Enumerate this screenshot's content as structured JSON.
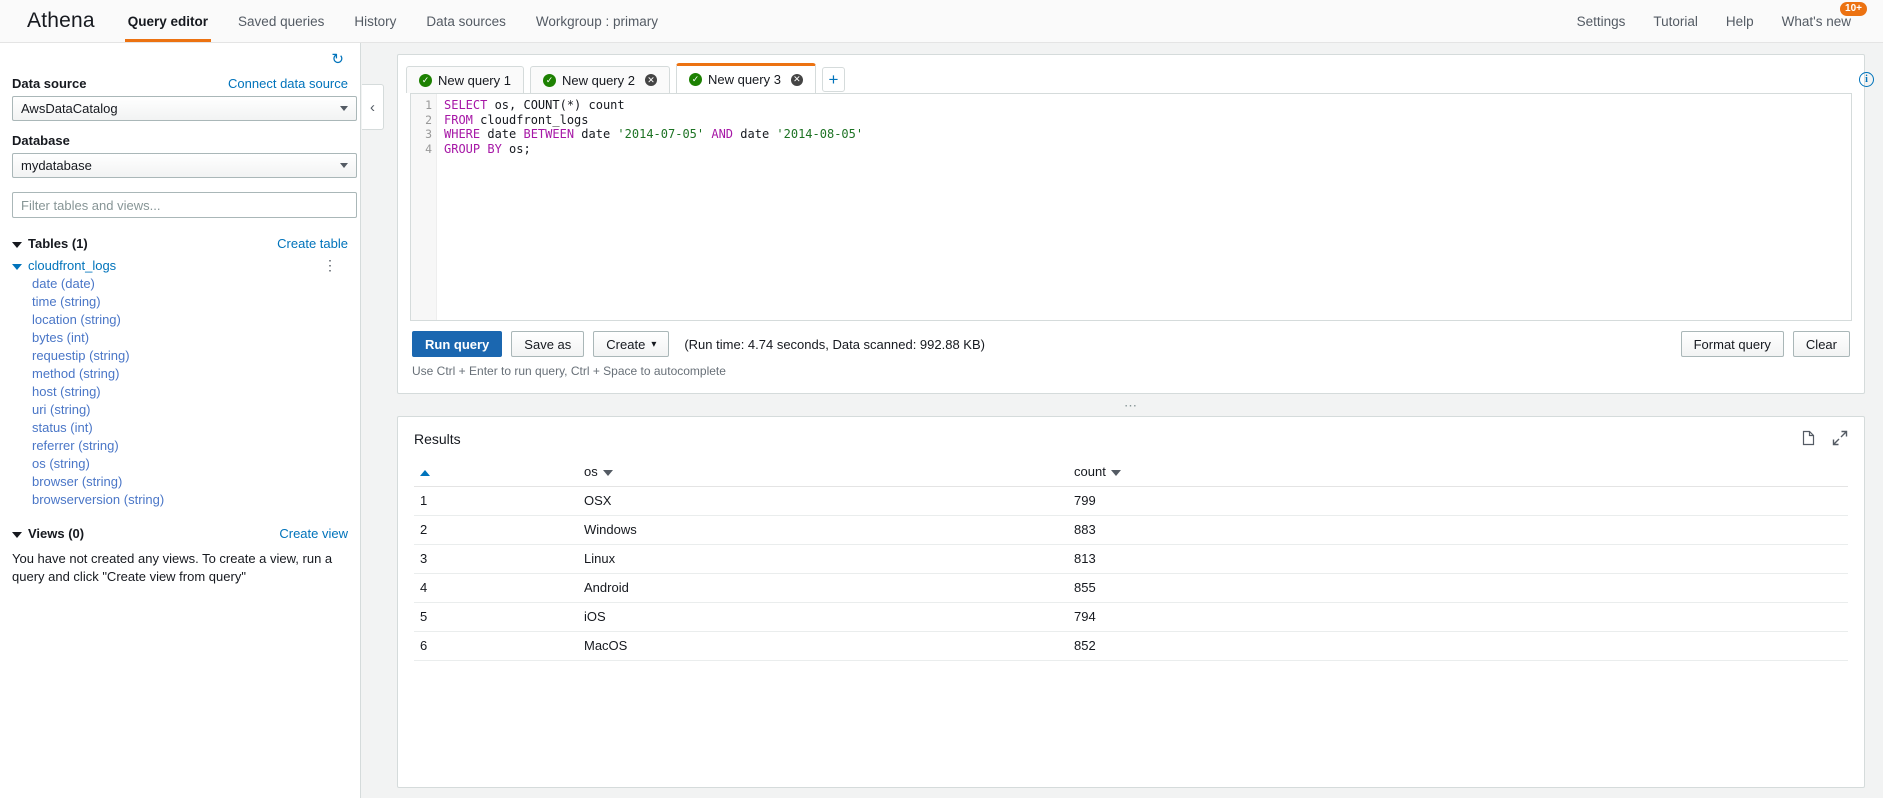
{
  "topnav": {
    "brand": "Athena",
    "items": [
      {
        "label": "Query editor",
        "active": true
      },
      {
        "label": "Saved queries",
        "active": false
      },
      {
        "label": "History",
        "active": false
      },
      {
        "label": "Data sources",
        "active": false
      },
      {
        "label": "Workgroup : primary",
        "active": false
      }
    ],
    "right_items": [
      {
        "label": "Settings"
      },
      {
        "label": "Tutorial"
      },
      {
        "label": "Help"
      },
      {
        "label": "What's new"
      }
    ],
    "badge": "10+"
  },
  "sidebar": {
    "refresh_icon": "refresh-icon",
    "data_source_label": "Data source",
    "connect_link": "Connect data source",
    "data_source_value": "AwsDataCatalog",
    "database_label": "Database",
    "database_value": "mydatabase",
    "filter_placeholder": "Filter tables and views...",
    "filter_value": "",
    "tables_heading": "Tables (1)",
    "create_table_link": "Create table",
    "table_name": "cloudfront_logs",
    "columns": [
      "date (date)",
      "time (string)",
      "location (string)",
      "bytes (int)",
      "requestip (string)",
      "method (string)",
      "host (string)",
      "uri (string)",
      "status (int)",
      "referrer (string)",
      "os (string)",
      "browser (string)",
      "browserversion (string)"
    ],
    "views_heading": "Views (0)",
    "create_view_link": "Create view",
    "views_empty_text": "You have not created any views. To create a view, run a query and click \"Create view from query\""
  },
  "editor": {
    "tabs": [
      {
        "label": "New query 1",
        "active": false,
        "closable": false,
        "status": "success"
      },
      {
        "label": "New query 2",
        "active": false,
        "closable": true,
        "status": "success"
      },
      {
        "label": "New query 3",
        "active": true,
        "closable": true,
        "status": "success"
      }
    ],
    "add_tab_label": "+",
    "line_numbers": [
      "1",
      "2",
      "3",
      "4"
    ],
    "sql_lines": [
      [
        {
          "t": "SELECT",
          "c": "kw"
        },
        {
          "t": " os, COUNT(*) count",
          "c": "fn"
        }
      ],
      [
        {
          "t": "FROM",
          "c": "kw"
        },
        {
          "t": " cloudfront_logs",
          "c": "fn"
        }
      ],
      [
        {
          "t": "WHERE",
          "c": "kw"
        },
        {
          "t": " date ",
          "c": "fn"
        },
        {
          "t": "BETWEEN",
          "c": "kw"
        },
        {
          "t": " date ",
          "c": "fn"
        },
        {
          "t": "'2014-07-05'",
          "c": "str"
        },
        {
          "t": " ",
          "c": "fn"
        },
        {
          "t": "AND",
          "c": "kw"
        },
        {
          "t": " date ",
          "c": "fn"
        },
        {
          "t": "'2014-08-05'",
          "c": "str"
        }
      ],
      [
        {
          "t": "GROUP",
          "c": "kw"
        },
        {
          "t": " ",
          "c": "fn"
        },
        {
          "t": "BY",
          "c": "kw"
        },
        {
          "t": " os;",
          "c": "fn"
        }
      ]
    ],
    "run_query_label": "Run query",
    "save_as_label": "Save as",
    "create_label": "Create",
    "run_info": "(Run time: 4.74 seconds, Data scanned: 992.88 KB)",
    "format_query_label": "Format query",
    "clear_label": "Clear",
    "hint": "Use Ctrl + Enter to run query, Ctrl + Space to autocomplete"
  },
  "results": {
    "title": "Results",
    "download_icon": "download-file-icon",
    "expand_icon": "expand-icon",
    "columns": [
      "",
      "os",
      "count"
    ],
    "rows": [
      {
        "idx": "1",
        "os": "OSX",
        "count": "799"
      },
      {
        "idx": "2",
        "os": "Windows",
        "count": "883"
      },
      {
        "idx": "3",
        "os": "Linux",
        "count": "813"
      },
      {
        "idx": "4",
        "os": "Android",
        "count": "855"
      },
      {
        "idx": "5",
        "os": "iOS",
        "count": "794"
      },
      {
        "idx": "6",
        "os": "MacOS",
        "count": "852"
      }
    ]
  },
  "colors": {
    "accent_orange": "#ec7211",
    "link_blue": "#0073bb",
    "primary_button": "#1b67b0",
    "success_green": "#1d8102"
  }
}
